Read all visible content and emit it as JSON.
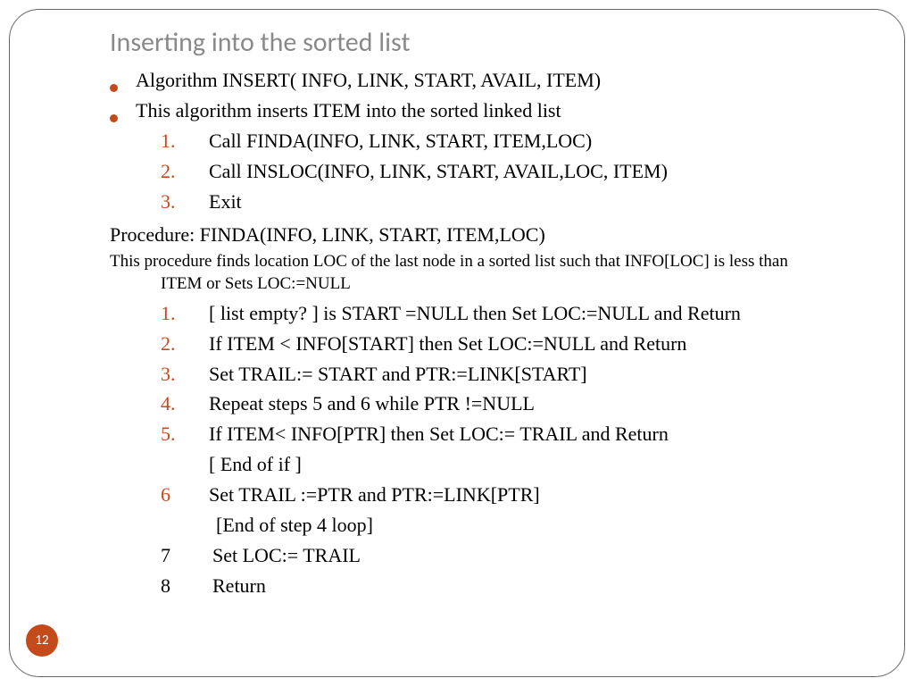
{
  "title": "Inserting into the sorted list",
  "page_number": "12",
  "bullets": [
    "Algorithm INSERT( INFO, LINK, START, AVAIL, ITEM)",
    "This algorithm inserts ITEM into the sorted linked list"
  ],
  "steps_a": [
    {
      "n": "1.",
      "t": "Call FINDA(INFO, LINK, START, ITEM,LOC)"
    },
    {
      "n": "2.",
      "t": "Call INSLOC(INFO, LINK, START, AVAIL,LOC, ITEM)"
    },
    {
      "n": "3.",
      "t": "Exit"
    }
  ],
  "proc_header": "Procedure: FINDA(INFO, LINK, START, ITEM,LOC)",
  "proc_desc_1": "This procedure finds location LOC of the last node in a sorted list such that INFO[LOC] is less than",
  "proc_desc_2": "ITEM or Sets LOC:=NULL",
  "steps_b": [
    {
      "n": "1.",
      "t": "[ list empty? ] is START =NULL then Set LOC:=NULL and Return"
    },
    {
      "n": "2.",
      "t": "If ITEM < INFO[START] then Set LOC:=NULL and Return"
    },
    {
      "n": "3.",
      "t": "Set TRAIL:= START and PTR:=LINK[START]"
    },
    {
      "n": "4.",
      "t": "Repeat steps 5 and 6 while PTR !=NULL"
    },
    {
      "n": "5.",
      "t": "If ITEM< INFO[PTR] then Set LOC:= TRAIL and Return"
    }
  ],
  "endif": "[ End of if ]",
  "step6": {
    "n": "6",
    "t": "Set TRAIL :=PTR and PTR:=LINK[PTR]"
  },
  "endloop": "[End of step 4 loop]",
  "step7": {
    "n": "7",
    "t": "Set LOC:= TRAIL"
  },
  "step8": {
    "n": "8",
    "t": "Return"
  }
}
